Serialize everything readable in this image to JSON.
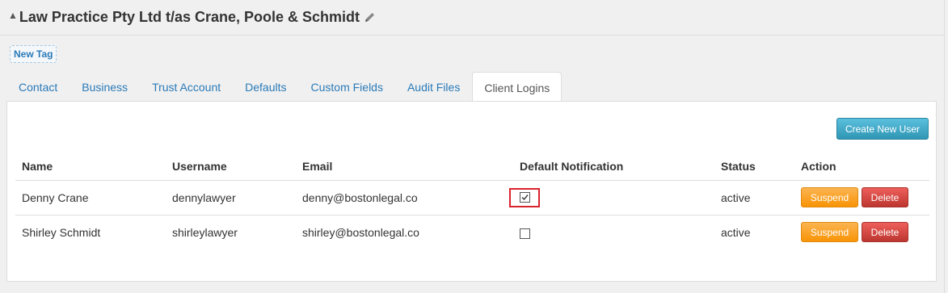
{
  "header": {
    "title": "Law Practice Pty Ltd t/as Crane, Poole & Schmidt",
    "collapse_icon": "caret-up-icon",
    "edit_icon": "pencil-icon"
  },
  "tags": {
    "new_tag_label": "New Tag"
  },
  "tabs": [
    {
      "label": "Contact"
    },
    {
      "label": "Business"
    },
    {
      "label": "Trust Account"
    },
    {
      "label": "Defaults"
    },
    {
      "label": "Custom Fields"
    },
    {
      "label": "Audit Files"
    },
    {
      "label": "Client Logins",
      "active": true
    }
  ],
  "panel": {
    "create_user_label": "Create New User",
    "columns": [
      "Name",
      "Username",
      "Email",
      "Default Notification",
      "Status",
      "Action"
    ],
    "rows": [
      {
        "name": "Denny Crane",
        "username": "dennylawyer",
        "email": "denny@bostonlegal.co",
        "default_notification": true,
        "status": "active",
        "suspend_label": "Suspend",
        "delete_label": "Delete"
      },
      {
        "name": "Shirley Schmidt",
        "username": "shirleylawyer",
        "email": "shirley@bostonlegal.co",
        "default_notification": false,
        "status": "active",
        "suspend_label": "Suspend",
        "delete_label": "Delete"
      }
    ]
  },
  "colors": {
    "link": "#2a7ab8",
    "info_button": "#3ba8ca",
    "warning_button": "#f89406",
    "danger_button": "#d9433c",
    "highlight_box": "#d9232e"
  }
}
